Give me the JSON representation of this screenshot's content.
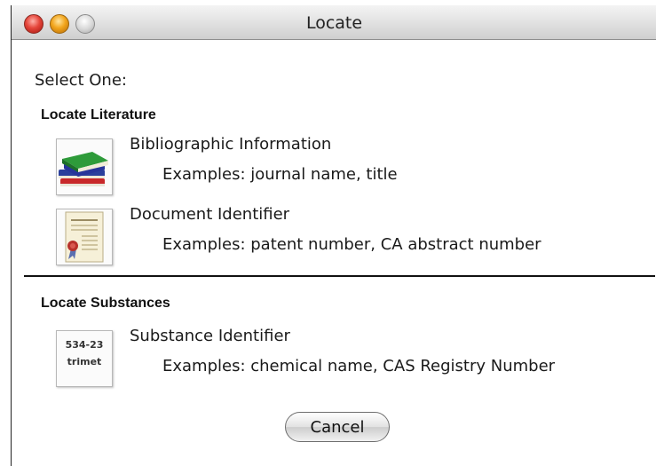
{
  "window": {
    "title": "Locate"
  },
  "dialog": {
    "prompt": "Select One:",
    "sections": [
      {
        "title": "Locate Literature",
        "items": [
          {
            "label": "Bibliographic Information",
            "example": "Examples: journal name, title",
            "icon": "books-icon"
          },
          {
            "label": "Document Identifier",
            "example": "Examples: patent number, CA abstract number",
            "icon": "certificate-document-icon"
          }
        ]
      },
      {
        "title": "Locate Substances",
        "items": [
          {
            "label": "Substance Identifier",
            "example": "Examples: chemical name, CAS Registry Number",
            "icon": "substance-id-icon",
            "icon_text": [
              "534-23",
              "trimet"
            ]
          }
        ]
      }
    ],
    "cancel_label": "Cancel"
  }
}
